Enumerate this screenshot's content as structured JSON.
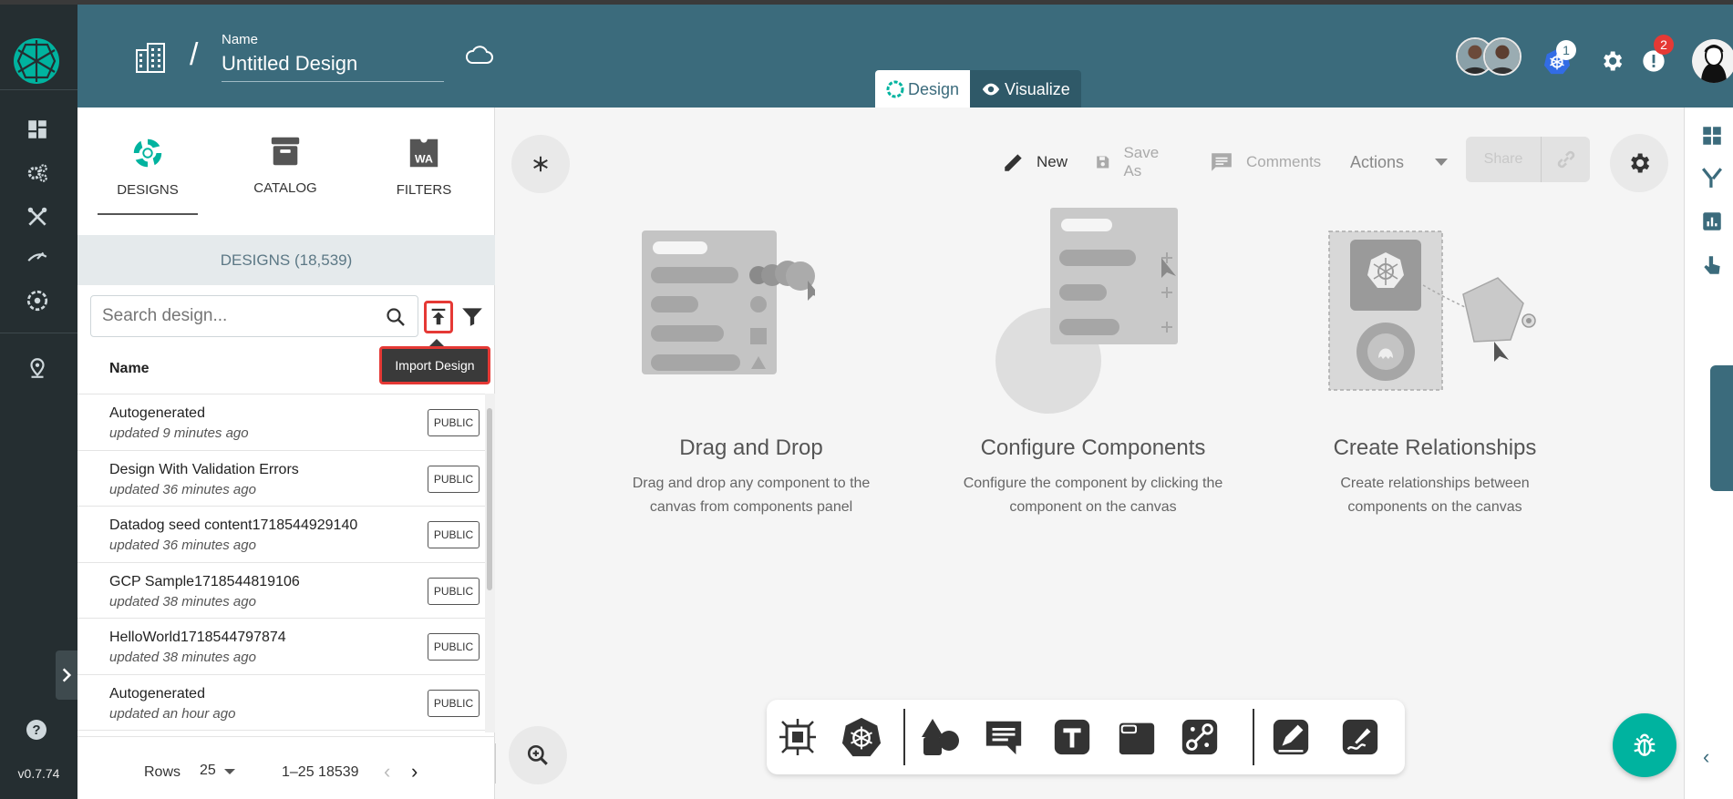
{
  "app": {
    "version": "v0.7.74"
  },
  "header": {
    "name_label": "Name",
    "design_name": "Untitled Design",
    "tabs": [
      {
        "label": "Design",
        "active": true
      },
      {
        "label": "Visualize",
        "active": false
      }
    ],
    "kubernetes_badge": "1",
    "notifications_badge": "2"
  },
  "panel": {
    "tabs": [
      {
        "label": "DESIGNS",
        "active": true
      },
      {
        "label": "CATALOG",
        "active": false
      },
      {
        "label": "FILTERS",
        "active": false
      }
    ],
    "filters_icon_text": "WA",
    "designs_count": "DESIGNS (18,539)",
    "search_placeholder": "Search design...",
    "tooltip": "Import Design",
    "column_name": "Name",
    "rows": [
      {
        "name": "Autogenerated",
        "updated": "updated 9 minutes ago",
        "visibility": "PUBLIC"
      },
      {
        "name": "Design With Validation Errors",
        "updated": "updated 36 minutes ago",
        "visibility": "PUBLIC"
      },
      {
        "name": "Datadog seed content1718544929140",
        "updated": "updated 36 minutes ago",
        "visibility": "PUBLIC"
      },
      {
        "name": "GCP Sample1718544819106",
        "updated": "updated 38 minutes ago",
        "visibility": "PUBLIC"
      },
      {
        "name": "HelloWorld1718544797874",
        "updated": "updated 38 minutes ago",
        "visibility": "PUBLIC"
      },
      {
        "name": "Autogenerated",
        "updated": "updated an hour ago",
        "visibility": "PUBLIC"
      }
    ],
    "pagination": {
      "rows_label": "Rows",
      "rows_per_page": "25",
      "range": "1–25 18539"
    }
  },
  "canvas": {
    "toolbar": {
      "new": "New",
      "save_as": "Save As",
      "comments": "Comments",
      "actions": "Actions",
      "share": "Share"
    },
    "features": [
      {
        "title": "Drag and Drop",
        "desc1": "Drag and drop any component to the",
        "desc2": "canvas from components panel"
      },
      {
        "title": "Configure Components",
        "desc1": "Configure the component by clicking the",
        "desc2": "component on the canvas"
      },
      {
        "title": "Create Relationships",
        "desc1": "Create relationships between",
        "desc2": "components on the canvas"
      }
    ]
  },
  "colors": {
    "header": "#3b6b7c",
    "rail": "#252e31",
    "accent": "#00b39f",
    "highlight": "#e53935"
  }
}
